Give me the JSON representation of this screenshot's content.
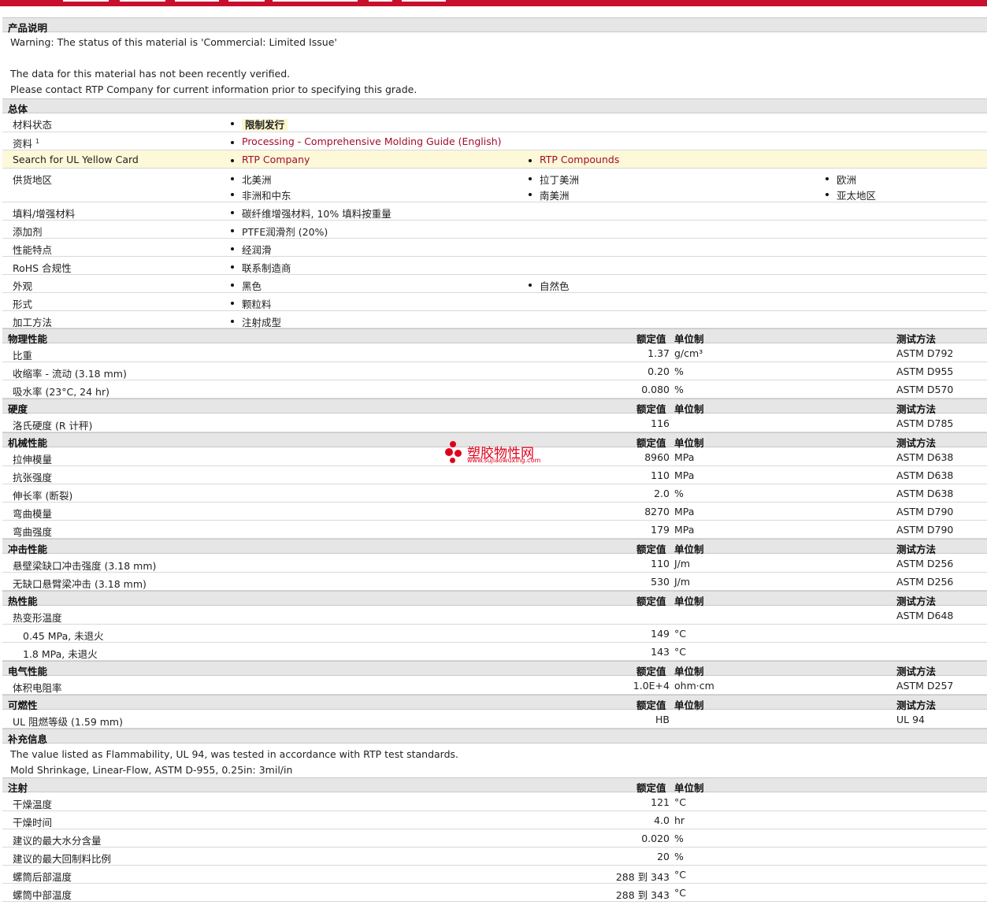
{
  "description": {
    "heading": "产品说明",
    "lines": [
      "Warning: The status of this material is 'Commercial: Limited Issue'",
      "The data for this material has not been recently verified.",
      "Please contact RTP Company for current information prior to specifying this grade."
    ]
  },
  "general": {
    "heading": "总体",
    "status_label": "材料状态",
    "status_value": "限制发行",
    "docs_label": "资料",
    "docs_sup": "1",
    "docs_link": "Processing - Comprehensive Molding Guide (English)",
    "ul_label": "Search for UL Yellow Card",
    "ul_links": [
      "RTP Company",
      "RTP Compounds"
    ],
    "region_label": "供货地区",
    "regions": [
      "北美洲",
      "拉丁美洲",
      "欧洲",
      "非洲和中东",
      "南美洲",
      "亚太地区"
    ],
    "filler_label": "填料/增强材料",
    "filler_value": "碳纤维增强材料, 10% 填料按重量",
    "additive_label": "添加剂",
    "additive_value": "PTFE润滑剂 (20%)",
    "feature_label": "性能特点",
    "feature_value": "经润滑",
    "rohs_label": "RoHS 合规性",
    "rohs_value": "联系制造商",
    "look_label": "外观",
    "look_values": [
      "黑色",
      "自然色"
    ],
    "form_label": "形式",
    "form_value": "颗粒料",
    "process_label": "加工方法",
    "process_value": "注射成型"
  },
  "columns": {
    "nominal": "额定值",
    "unit": "单位制",
    "test": "测试方法"
  },
  "physical": {
    "heading": "物理性能",
    "rows": [
      {
        "name": "比重",
        "value": "1.37",
        "unit": "g/cm³",
        "test": "ASTM D792"
      },
      {
        "name": "收缩率 - 流动 (3.18 mm)",
        "value": "0.20",
        "unit": "%",
        "test": "ASTM D955"
      },
      {
        "name": "吸水率 (23°C, 24 hr)",
        "value": "0.080",
        "unit": "%",
        "test": "ASTM D570"
      }
    ]
  },
  "hardness": {
    "heading": "硬度",
    "rows": [
      {
        "name": "洛氏硬度 (R 计秤)",
        "value": "116",
        "unit": "",
        "test": "ASTM D785"
      }
    ]
  },
  "mechanical": {
    "heading": "机械性能",
    "rows": [
      {
        "name": "拉伸模量",
        "value": "8960",
        "unit": "MPa",
        "test": "ASTM D638"
      },
      {
        "name": "抗张强度",
        "value": "110",
        "unit": "MPa",
        "test": "ASTM D638"
      },
      {
        "name": "伸长率 (断裂)",
        "value": "2.0",
        "unit": "%",
        "test": "ASTM D638"
      },
      {
        "name": "弯曲模量",
        "value": "8270",
        "unit": "MPa",
        "test": "ASTM D790"
      },
      {
        "name": "弯曲强度",
        "value": "179",
        "unit": "MPa",
        "test": "ASTM D790"
      }
    ]
  },
  "impact": {
    "heading": "冲击性能",
    "rows": [
      {
        "name": "悬壁梁缺口冲击强度 (3.18 mm)",
        "value": "110",
        "unit": "J/m",
        "test": "ASTM D256"
      },
      {
        "name": "无缺口悬臂梁冲击 (3.18 mm)",
        "value": "530",
        "unit": "J/m",
        "test": "ASTM D256"
      }
    ]
  },
  "thermal": {
    "heading": "热性能",
    "parent": {
      "name": "热变形温度",
      "test": "ASTM D648"
    },
    "rows": [
      {
        "name": "0.45 MPa, 未退火",
        "value": "149",
        "unit": "°C"
      },
      {
        "name": "1.8 MPa, 未退火",
        "value": "143",
        "unit": "°C"
      }
    ]
  },
  "electrical": {
    "heading": "电气性能",
    "rows": [
      {
        "name": "体积电阻率",
        "value": "1.0E+4",
        "unit": "ohm·cm",
        "test": "ASTM D257"
      }
    ]
  },
  "flammability": {
    "heading": "可燃性",
    "rows": [
      {
        "name": "UL 阻燃等级 (1.59 mm)",
        "value": "HB",
        "unit": "",
        "test": "UL 94"
      }
    ]
  },
  "supplement": {
    "heading": "补充信息",
    "lines": [
      "The value listed as Flammability, UL 94, was tested in accordance with RTP test standards.",
      "Mold Shrinkage, Linear-Flow, ASTM D-955, 0.25in: 3mil/in"
    ]
  },
  "injection": {
    "heading": "注射",
    "rows": [
      {
        "name": "干燥温度",
        "value": "121",
        "unit": "°C"
      },
      {
        "name": "干燥时间",
        "value": "4.0",
        "unit": "hr"
      },
      {
        "name": "建议的最大水分含量",
        "value": "0.020",
        "unit": "%"
      },
      {
        "name": "建议的最大回制料比例",
        "value": "20",
        "unit": "%"
      },
      {
        "name": "螺筒后部温度",
        "value": "288 到  343",
        "unit": "°C"
      },
      {
        "name": "螺筒中部温度",
        "value": "288 到  343",
        "unit": "°C"
      }
    ]
  },
  "watermark": {
    "name": "塑胶物性网",
    "url": "www.sujiaowuxing.com"
  }
}
